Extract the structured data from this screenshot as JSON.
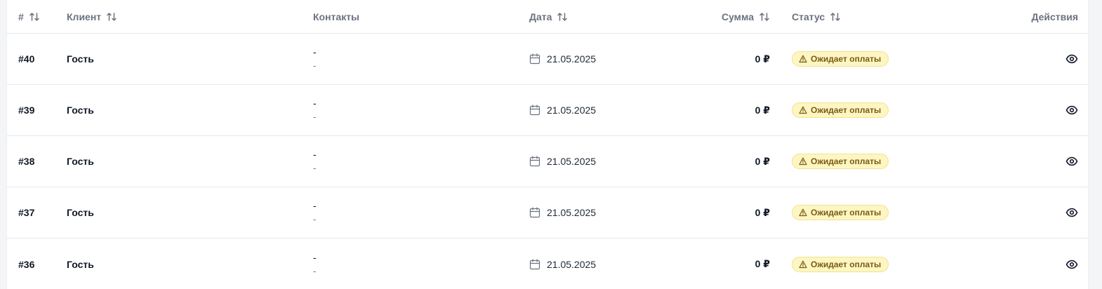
{
  "table": {
    "headers": {
      "id": "#",
      "client": "Клиент",
      "contacts": "Контакты",
      "date": "Дата",
      "sum": "Сумма",
      "status": "Статус",
      "actions": "Действия"
    },
    "rows": [
      {
        "id": "#40",
        "client": "Гость",
        "contact_primary": "-",
        "contact_secondary": "-",
        "date": "21.05.2025",
        "sum": "0 ₽",
        "status": "Ожидает оплаты"
      },
      {
        "id": "#39",
        "client": "Гость",
        "contact_primary": "-",
        "contact_secondary": "-",
        "date": "21.05.2025",
        "sum": "0 ₽",
        "status": "Ожидает оплаты"
      },
      {
        "id": "#38",
        "client": "Гость",
        "contact_primary": "-",
        "contact_secondary": "-",
        "date": "21.05.2025",
        "sum": "0 ₽",
        "status": "Ожидает оплаты"
      },
      {
        "id": "#37",
        "client": "Гость",
        "contact_primary": "-",
        "contact_secondary": "-",
        "date": "21.05.2025",
        "sum": "0 ₽",
        "status": "Ожидает оплаты"
      },
      {
        "id": "#36",
        "client": "Гость",
        "contact_primary": "-",
        "contact_secondary": "-",
        "date": "21.05.2025",
        "sum": "0 ₽",
        "status": "Ожидает оплаты"
      }
    ]
  },
  "icons": {
    "sort": "sort-arrows-icon",
    "date": "calendar-icon",
    "status": "warning-triangle-icon",
    "view": "eye-icon"
  },
  "colors": {
    "header_text": "#6b7280",
    "badge_bg": "#fdf6c3",
    "badge_border": "#f1e38e",
    "badge_text": "#7a5b12",
    "row_divider": "#e6e8eb"
  }
}
